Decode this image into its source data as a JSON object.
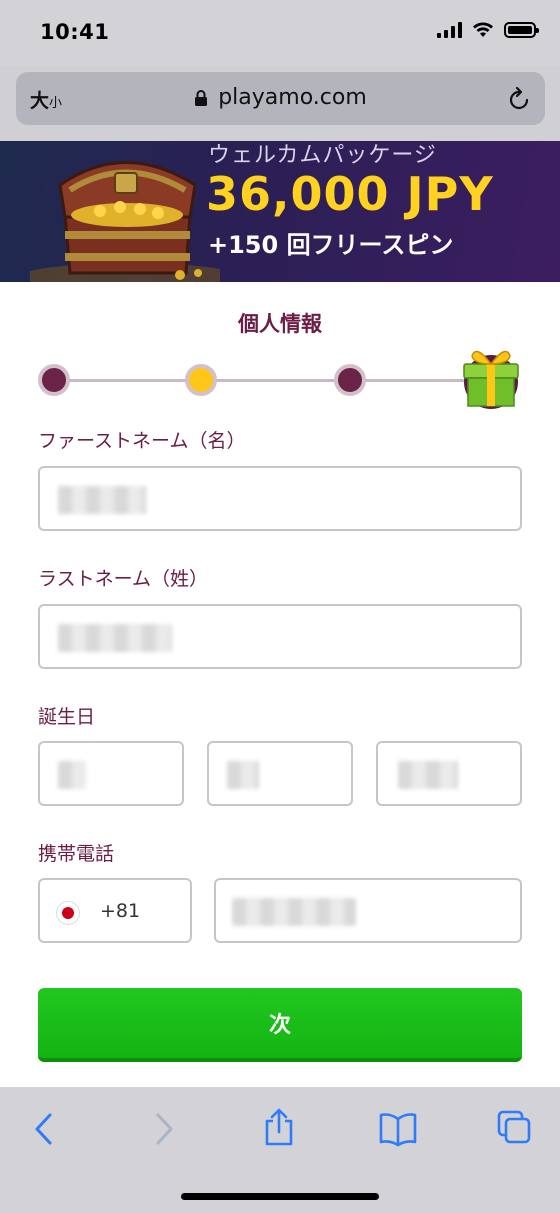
{
  "status_bar": {
    "time": "10:41"
  },
  "browser": {
    "text_size_label": "大",
    "text_size_small": "小",
    "url": "playamo.com"
  },
  "banner": {
    "headline": "ウェルカムパッケージ",
    "amount": "36,000 JPY",
    "spins": "+150 回フリースピン"
  },
  "form": {
    "title": "個人情報",
    "steps": [
      {
        "state": "done"
      },
      {
        "state": "active"
      },
      {
        "state": "done"
      }
    ],
    "first_name": {
      "label": "ファーストネーム（名）",
      "value": ""
    },
    "last_name": {
      "label": "ラストネーム（姓）",
      "value": ""
    },
    "birthday": {
      "label": "誕生日",
      "day": "",
      "month": "",
      "year": ""
    },
    "phone": {
      "label": "携帯電話",
      "country_code": "+81",
      "number": ""
    },
    "next_label": "次"
  },
  "toolbar": {
    "icons": [
      "back-icon",
      "forward-icon",
      "share-icon",
      "bookmarks-icon",
      "tabs-icon"
    ]
  },
  "colors": {
    "accent": "#6b1d46",
    "step_active": "#ffc61a",
    "button": "#1bbd19",
    "ios_blue": "#2f7cf6",
    "amount": "#ffd21f"
  }
}
